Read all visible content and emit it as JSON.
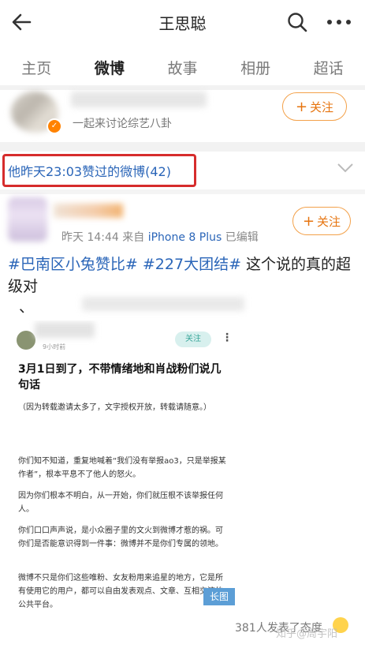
{
  "header": {
    "title": "王思聪"
  },
  "tabs": [
    {
      "label": "主页"
    },
    {
      "label": "微博"
    },
    {
      "label": "故事"
    },
    {
      "label": "相册"
    },
    {
      "label": "超话"
    }
  ],
  "card1": {
    "desc": "一起来讨论综艺八卦",
    "follow_label": "关注"
  },
  "liked": {
    "label": "他昨天23:03赞过的微博(42)"
  },
  "post": {
    "time": "昨天 14:44",
    "from": "来自",
    "device": "iPhone 8 Plus",
    "edited": "已编辑",
    "follow_label": "关注",
    "topic1": "#巴南区小兔赞比#",
    "topic2": "#227大团结#",
    "text": " 这个说的真的超级对",
    "text2": "、"
  },
  "screenshot": {
    "time": "9小时前",
    "follow_label": "关注",
    "title": "3月1日到了，不带情绪地和肖战粉们说几句话",
    "paragraphs": [
      "（因为转载邀请太多了，文字授权开放，转载请随意。）",
      "你们知不知道，重复地喊着“我们没有举报ao3，只是举报某作者”，根本平息不了他人的怒火。",
      "因为你们根本不明白，从一开始，你们就压根不该举报任何人。",
      "你们口口声声说，是小众圈子里的文火到微博才惹的祸。可你们是否能意识得到一件事：微博并不是你们专属的领地。",
      "微博不只是你们这些唯粉、女友粉用来追星的地方，它是所有使用它的用户，都可以自由发表观点、文章、互相交流的公共平台。"
    ],
    "long_image_label": "长图"
  },
  "footer": {
    "count_text": "381人发表了态度",
    "watermark": "知乎@周宇阳"
  },
  "colors": {
    "accent": "#ff8200",
    "link": "#2a65b8",
    "highlight_box": "#d62c2c"
  }
}
